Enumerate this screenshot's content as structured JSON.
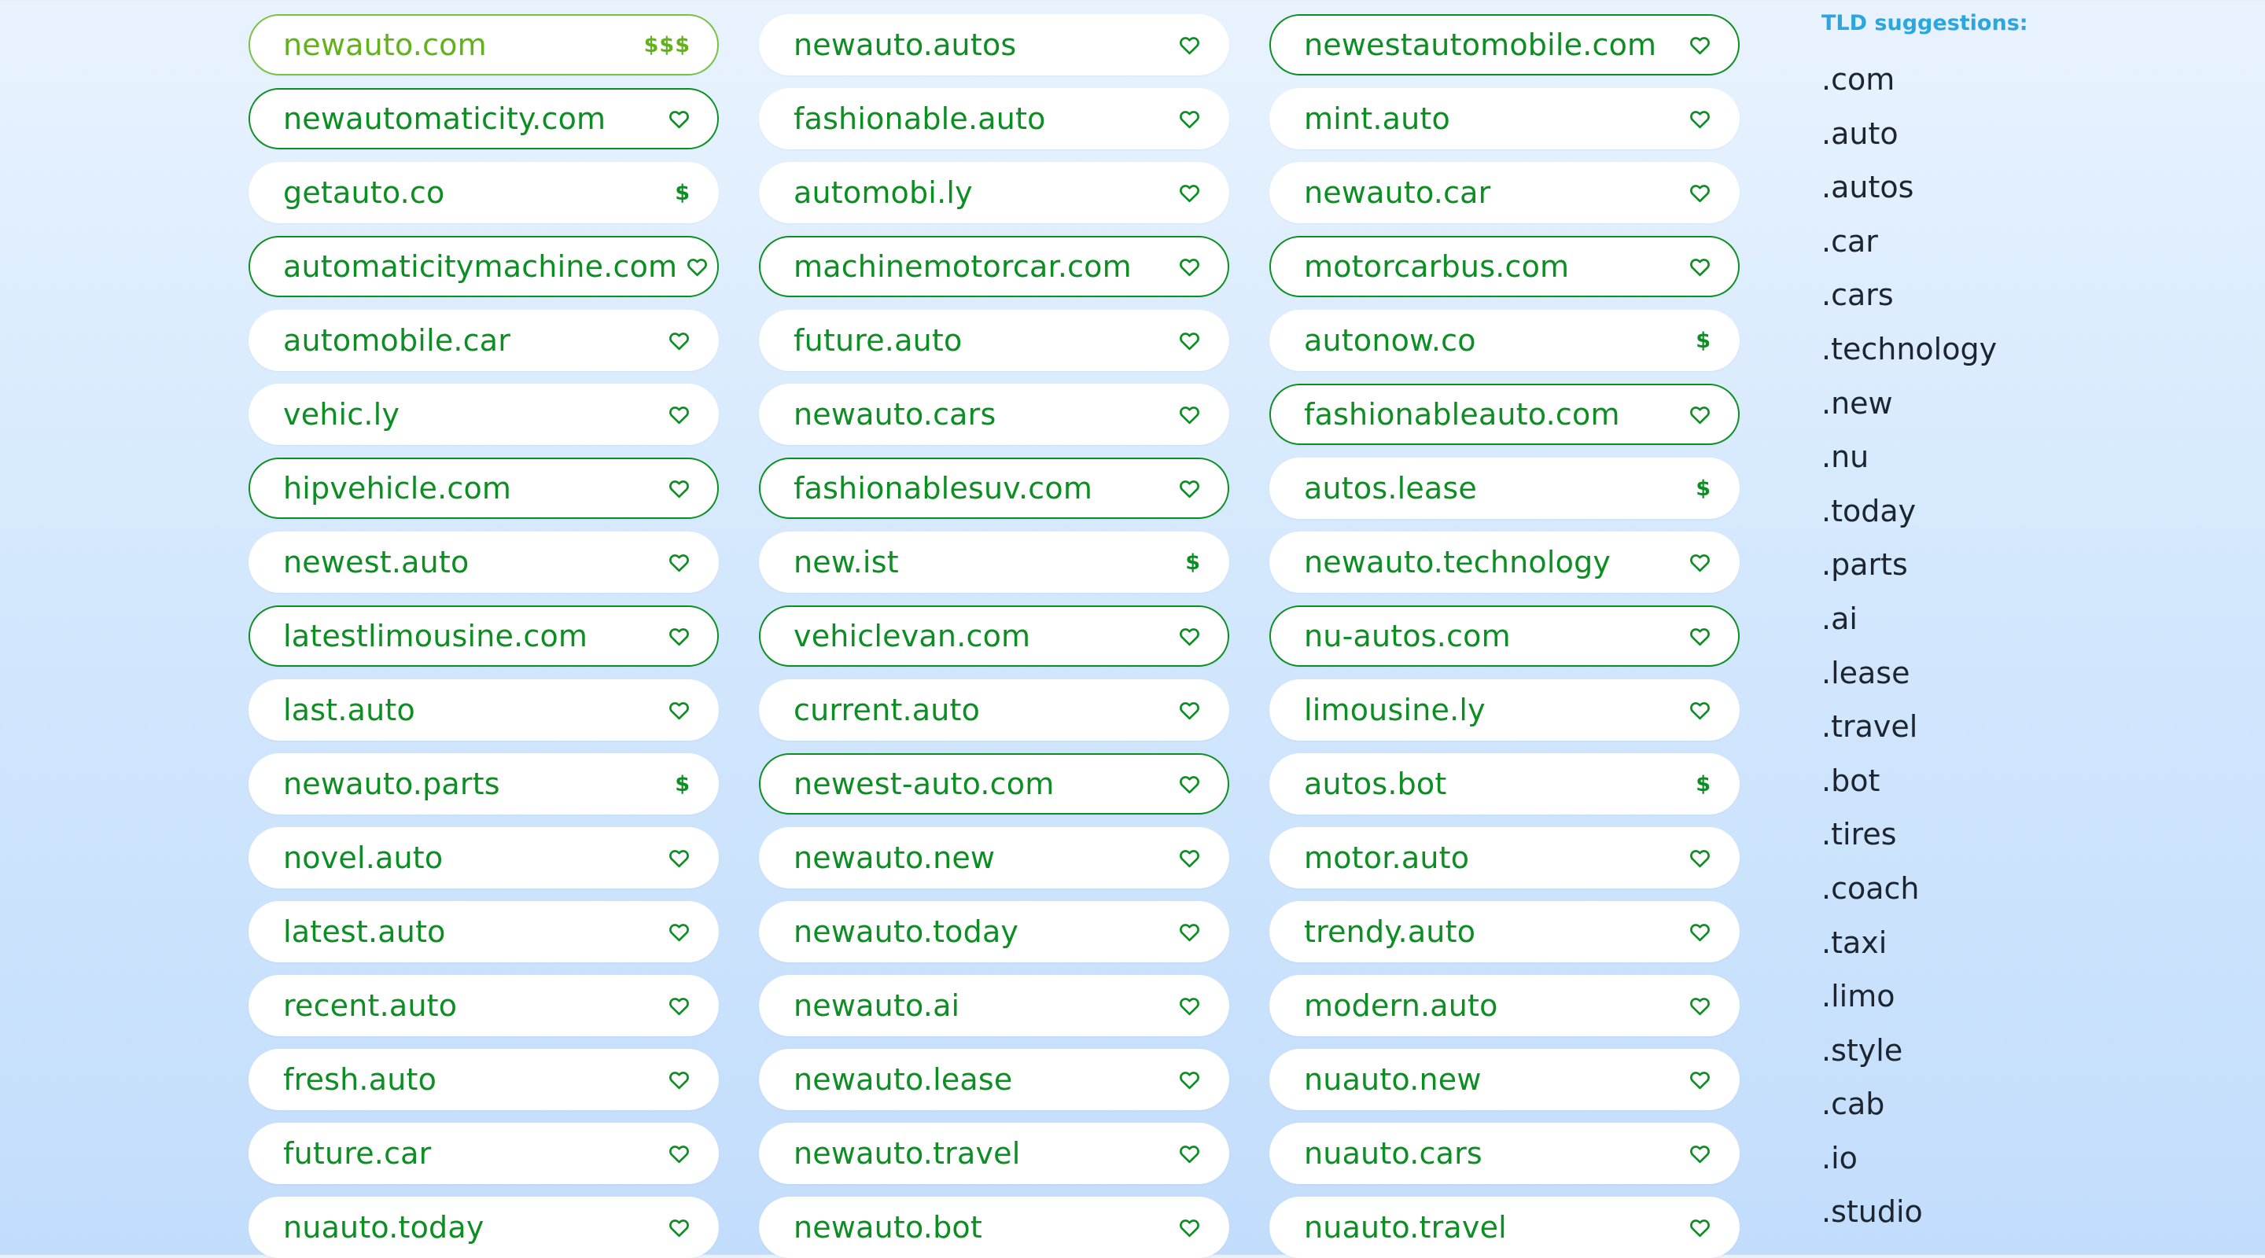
{
  "colors": {
    "accent_green": "#0c8f22",
    "featured_green": "#62b31a",
    "tld_title_blue": "#2ba6de",
    "tld_text": "#1c2530"
  },
  "domains": [
    {
      "name": "newauto.com",
      "badge": "price",
      "price": "$$$",
      "style": "featured"
    },
    {
      "name": "newauto.autos",
      "badge": "heart-icon",
      "style": "plain"
    },
    {
      "name": "newestautomobile.com",
      "badge": "heart-icon",
      "style": "outlined"
    },
    {
      "name": "newautomaticity.com",
      "badge": "heart-icon",
      "style": "outlined"
    },
    {
      "name": "fashionable.auto",
      "badge": "heart-icon",
      "style": "plain"
    },
    {
      "name": "mint.auto",
      "badge": "heart-icon",
      "style": "plain"
    },
    {
      "name": "getauto.co",
      "badge": "price",
      "price": "$",
      "style": "plain"
    },
    {
      "name": "automobi.ly",
      "badge": "heart-icon",
      "style": "plain"
    },
    {
      "name": "newauto.car",
      "badge": "heart-icon",
      "style": "plain"
    },
    {
      "name": "automaticitymachine.com",
      "badge": "heart-icon",
      "style": "outlined"
    },
    {
      "name": "machinemotorcar.com",
      "badge": "heart-icon",
      "style": "outlined"
    },
    {
      "name": "motorcarbus.com",
      "badge": "heart-icon",
      "style": "outlined"
    },
    {
      "name": "automobile.car",
      "badge": "heart-icon",
      "style": "plain"
    },
    {
      "name": "future.auto",
      "badge": "heart-icon",
      "style": "plain"
    },
    {
      "name": "autonow.co",
      "badge": "price",
      "price": "$",
      "style": "plain"
    },
    {
      "name": "vehic.ly",
      "badge": "heart-icon",
      "style": "plain"
    },
    {
      "name": "newauto.cars",
      "badge": "heart-icon",
      "style": "plain"
    },
    {
      "name": "fashionableauto.com",
      "badge": "heart-icon",
      "style": "outlined"
    },
    {
      "name": "hipvehicle.com",
      "badge": "heart-icon",
      "style": "outlined"
    },
    {
      "name": "fashionablesuv.com",
      "badge": "heart-icon",
      "style": "outlined"
    },
    {
      "name": "autos.lease",
      "badge": "price",
      "price": "$",
      "style": "plain"
    },
    {
      "name": "newest.auto",
      "badge": "heart-icon",
      "style": "plain"
    },
    {
      "name": "new.ist",
      "badge": "price",
      "price": "$",
      "style": "plain"
    },
    {
      "name": "newauto.technology",
      "badge": "heart-icon",
      "style": "plain"
    },
    {
      "name": "latestlimousine.com",
      "badge": "heart-icon",
      "style": "outlined"
    },
    {
      "name": "vehiclevan.com",
      "badge": "heart-icon",
      "style": "outlined"
    },
    {
      "name": "nu-autos.com",
      "badge": "heart-icon",
      "style": "outlined"
    },
    {
      "name": "last.auto",
      "badge": "heart-icon",
      "style": "plain"
    },
    {
      "name": "current.auto",
      "badge": "heart-icon",
      "style": "plain"
    },
    {
      "name": "limousine.ly",
      "badge": "heart-icon",
      "style": "plain"
    },
    {
      "name": "newauto.parts",
      "badge": "price",
      "price": "$",
      "style": "plain"
    },
    {
      "name": "newest-auto.com",
      "badge": "heart-icon",
      "style": "outlined"
    },
    {
      "name": "autos.bot",
      "badge": "price",
      "price": "$",
      "style": "plain"
    },
    {
      "name": "novel.auto",
      "badge": "heart-icon",
      "style": "plain"
    },
    {
      "name": "newauto.new",
      "badge": "heart-icon",
      "style": "plain"
    },
    {
      "name": "motor.auto",
      "badge": "heart-icon",
      "style": "plain"
    },
    {
      "name": "latest.auto",
      "badge": "heart-icon",
      "style": "plain"
    },
    {
      "name": "newauto.today",
      "badge": "heart-icon",
      "style": "plain"
    },
    {
      "name": "trendy.auto",
      "badge": "heart-icon",
      "style": "plain"
    },
    {
      "name": "recent.auto",
      "badge": "heart-icon",
      "style": "plain"
    },
    {
      "name": "newauto.ai",
      "badge": "heart-icon",
      "style": "plain"
    },
    {
      "name": "modern.auto",
      "badge": "heart-icon",
      "style": "plain"
    },
    {
      "name": "fresh.auto",
      "badge": "heart-icon",
      "style": "plain"
    },
    {
      "name": "newauto.lease",
      "badge": "heart-icon",
      "style": "plain"
    },
    {
      "name": "nuauto.new",
      "badge": "heart-icon",
      "style": "plain"
    },
    {
      "name": "future.car",
      "badge": "heart-icon",
      "style": "plain"
    },
    {
      "name": "newauto.travel",
      "badge": "heart-icon",
      "style": "plain"
    },
    {
      "name": "nuauto.cars",
      "badge": "heart-icon",
      "style": "plain"
    },
    {
      "name": "nuauto.today",
      "badge": "heart-icon",
      "style": "plain"
    },
    {
      "name": "newauto.bot",
      "badge": "heart-icon",
      "style": "plain"
    },
    {
      "name": "nuauto.travel",
      "badge": "heart-icon",
      "style": "plain"
    }
  ],
  "tld_panel": {
    "title": "TLD suggestions:",
    "items": [
      ".com",
      ".auto",
      ".autos",
      ".car",
      ".cars",
      ".technology",
      ".new",
      ".nu",
      ".today",
      ".parts",
      ".ai",
      ".lease",
      ".travel",
      ".bot",
      ".tires",
      ".coach",
      ".taxi",
      ".limo",
      ".style",
      ".cab",
      ".io",
      ".studio"
    ]
  }
}
